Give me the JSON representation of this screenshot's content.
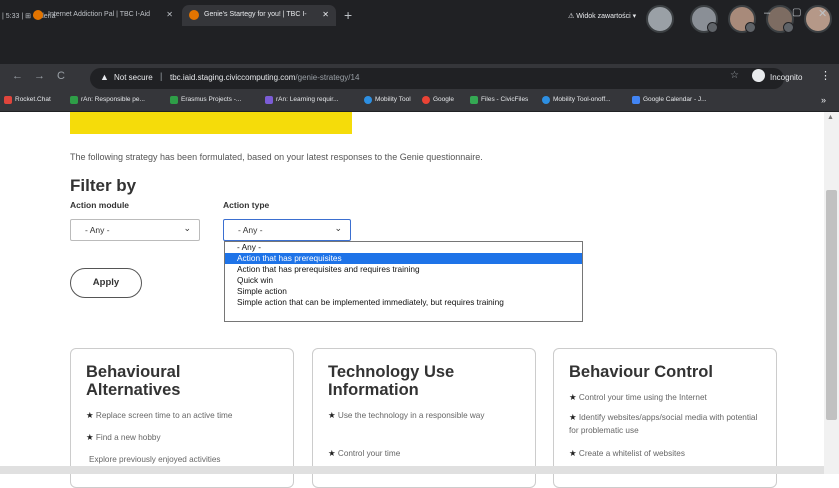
{
  "meeting": {
    "left_text": "| 5:33 | ⊞ Galeria",
    "view_label": "Widok zawartości",
    "avatar_count": 5
  },
  "tabs": [
    {
      "label": "Internet Addiction Pal | TBC I-Aid",
      "active": false
    },
    {
      "label": "Genie's Startegy for you! | TBC I-",
      "active": true
    }
  ],
  "window": {
    "new_tab": "+",
    "minimize": "–",
    "maximize": "▢",
    "close": "✕"
  },
  "toolbar": {
    "back": "←",
    "forward": "→",
    "reload": "C",
    "security": "Not secure",
    "url_host": "tbc.iaid.staging.civiccomputing.com",
    "url_path": "/genie-strategy/14",
    "star": "☆",
    "incognito": "Incognito",
    "more": "⋮"
  },
  "bookmarks": [
    {
      "label": "Rocket.Chat",
      "color": "#e0453c"
    },
    {
      "label": "rAn: Responsible pe...",
      "color": "#2e9e47"
    },
    {
      "label": "Erasmus Projects -...",
      "color": "#2e9e47"
    },
    {
      "label": "rAn: Learning requir...",
      "color": "#7b5cd6"
    },
    {
      "label": "Mobility Tool",
      "color": "#2d8fe2"
    },
    {
      "label": "Google",
      "color": "#ea4335"
    },
    {
      "label": "Files - CivicFiles",
      "color": "#34a853"
    },
    {
      "label": "Mobility Tool-onoff...",
      "color": "#2d8fe2"
    },
    {
      "label": "Google Calendar - J...",
      "color": "#4285f4"
    }
  ],
  "bookmarks_more": "»",
  "page": {
    "intro": "The following strategy has been formulated, based on your latest responses to the Genie questionnaire.",
    "filter_title": "Filter by",
    "module_label": "Action module",
    "type_label": "Action type",
    "module_value": "- Any -",
    "type_value": "- Any -",
    "type_options": [
      "- Any -",
      "Action that has prerequisites",
      "Action that has prerequisites and requires training",
      "Quick win",
      "Simple action",
      "Simple action that can be implemented immediately, but requires training"
    ],
    "highlighted_option_index": 1,
    "apply_label": "Apply"
  },
  "cards": [
    {
      "title_line1": "Behavioural",
      "title_line2": "Alternatives",
      "items": [
        "Replace screen time to an active time",
        "Find a new hobby",
        "Explore previously enjoyed activities"
      ]
    },
    {
      "title_line1": "Technology Use",
      "title_line2": "Information",
      "items": [
        "Use the technology in a responsible way",
        "Control your time"
      ]
    },
    {
      "title_line1": "Behaviour Control",
      "title_line2": "",
      "items": [
        "Control your time using the Internet",
        "Identify websites/apps/social media with potential for problematic use",
        "Create a whitelist of websites"
      ]
    }
  ],
  "colors": {
    "accent_yellow": "#f5dc0a",
    "selection_blue": "#1e73e8"
  }
}
